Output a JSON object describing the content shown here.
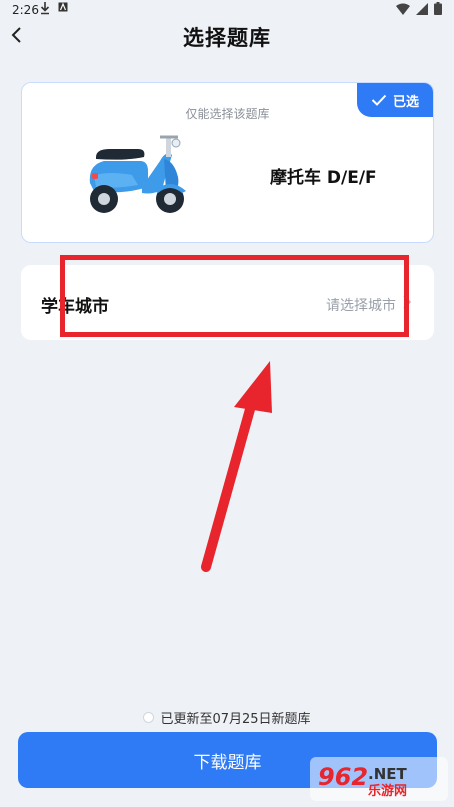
{
  "status_bar": {
    "time": "2:26"
  },
  "header": {
    "title": "选择题库"
  },
  "bank_card": {
    "badge": "已选",
    "hint": "仅能选择该题库",
    "name": "摩托车 D/E/F"
  },
  "city_row": {
    "label": "学车城市",
    "placeholder": "请选择城市"
  },
  "footer": {
    "update_text": "已更新至07月25日新题库",
    "download_label": "下载题库"
  },
  "watermark": {
    "brand": "962.NET",
    "subtitle": "乐游网"
  },
  "colors": {
    "accent": "#2f7bf5",
    "annotation": "#e8242c",
    "background": "#eef1f6"
  }
}
